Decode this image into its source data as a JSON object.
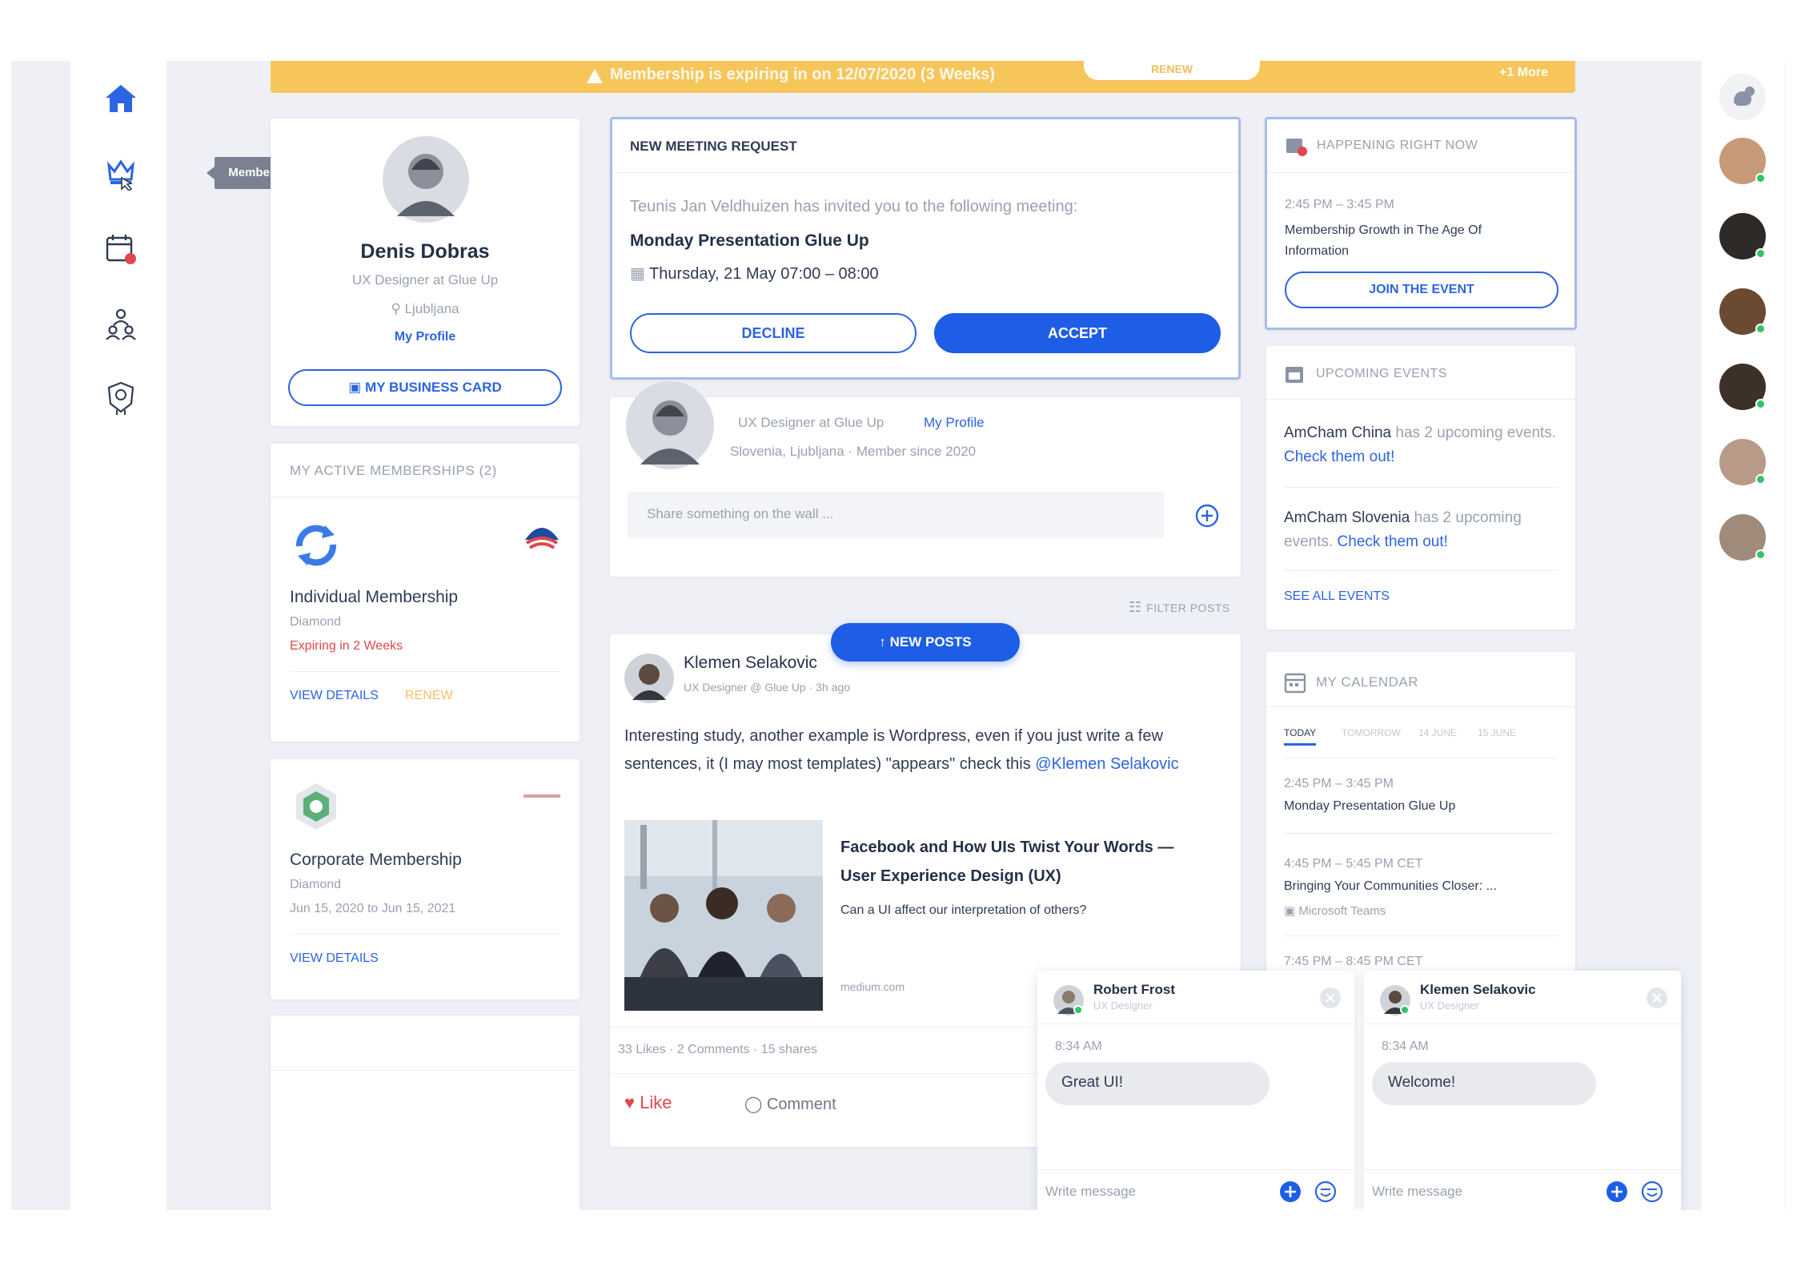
{
  "left_nav": {
    "tooltip": "Member Directory",
    "icons": [
      "home-icon",
      "member-directory-icon",
      "calendar-icon",
      "members-icon",
      "award-icon"
    ]
  },
  "banner": {
    "message": "Membership is expiring in on 12/07/2020 (3 Weeks)",
    "renew_label": "RENEW",
    "more_label": "+1 More"
  },
  "profile": {
    "name": "Denis Dobras",
    "title": "UX Designer at Glue Up",
    "location": "Ljubljana",
    "profile_link": "My Profile",
    "business_card_button": "MY BUSINESS CARD"
  },
  "memberships": {
    "header": "MY ACTIVE MEMBERSHIPS (2)",
    "items": [
      {
        "name": "Individual Membership",
        "tier": "Diamond",
        "status": "Expiring in 2 Weeks",
        "view_details": "VIEW DETAILS",
        "renew": "RENEW"
      },
      {
        "name": "Corporate Membership",
        "tier": "Diamond",
        "dates": "Jun 15, 2020 to Jun 15, 2021",
        "view_details": "VIEW DETAILS"
      }
    ]
  },
  "meeting_request": {
    "header": "NEW MEETING REQUEST",
    "invite_text": "Teunis Jan Veldhuizen has invited you to the following meeting:",
    "meeting_title": "Monday Presentation Glue Up",
    "meeting_time": "Thursday, 21 May 07:00 – 08:00",
    "decline_label": "DECLINE",
    "accept_label": "ACCEPT"
  },
  "composer": {
    "title": "UX Designer at Glue Up",
    "profile_link": "My Profile",
    "location_since": "Slovenia, Ljubljana · Member since 2020",
    "placeholder": "Share something on the wall ..."
  },
  "filter_posts": "FILTER POSTS",
  "new_posts_label": "↑ NEW POSTS",
  "post": {
    "author": "Klemen Selakovic",
    "meta": "UX Designer @ Glue Up · 3h ago",
    "body": "Interesting study, another example is Wordpress, even if you just write a few sentences, it (I may most templates) \"appears\" check this",
    "mention": "@Klemen Selakovic",
    "link_title": "Facebook and How UIs Twist Your Words — User Experience Design (UX)",
    "link_desc": "Can a UI affect our interpretation of others?",
    "link_domain": "medium.com",
    "stats": "33 Likes · 2 Comments · 15 shares",
    "like_label": "Like",
    "comment_label": "Comment"
  },
  "happening_now": {
    "header": "HAPPENING RIGHT NOW",
    "time": "2:45 PM – 3:45 PM",
    "title": "Membership Growth in The Age Of Information",
    "button": "JOIN THE EVENT"
  },
  "upcoming_events": {
    "header": "UPCOMING EVENTS",
    "items": [
      {
        "org": "AmCham China",
        "text": "has 2 upcoming events.",
        "link": "Check them out!"
      },
      {
        "org": "AmCham Slovenia",
        "text": "has 2 upcoming events.",
        "link": "Check them out!"
      }
    ],
    "see_all": "SEE ALL EVENTS"
  },
  "my_calendar": {
    "header": "MY CALENDAR",
    "tabs": [
      "TODAY",
      "TOMORROW",
      "14 JUNE",
      "15 JUNE"
    ],
    "events": [
      {
        "time": "2:45 PM – 3:45 PM",
        "title": "Monday Presentation Glue Up",
        "sub": ""
      },
      {
        "time": "4:45 PM – 5:45 PM CET",
        "title": "Bringing Your Communities Closer: ...",
        "sub": "Microsoft Teams"
      },
      {
        "time": "7:45 PM – 8:45 PM CET",
        "title": "",
        "sub": ""
      }
    ]
  },
  "chats": [
    {
      "name": "Robert Frost",
      "role": "UX Designer",
      "time": "8:34 AM",
      "message": "Great UI!",
      "placeholder": "Write message"
    },
    {
      "name": "Klemen Selakovic",
      "role": "UX Designer",
      "time": "8:34 AM",
      "message": "Welcome!",
      "placeholder": "Write message"
    }
  ],
  "colors": {
    "accent": "#1e5de6",
    "banner": "#f7c65a",
    "danger": "#e0474c",
    "online": "#34c26a",
    "background": "#eef0f5"
  }
}
